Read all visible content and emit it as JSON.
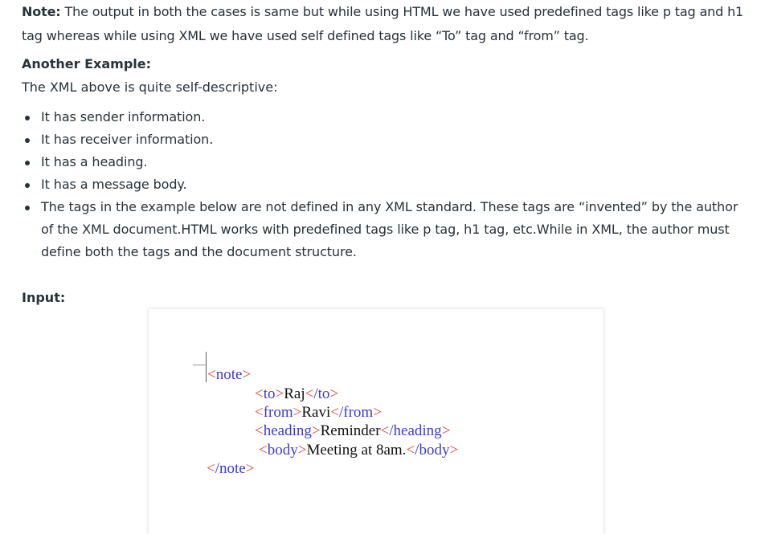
{
  "note": {
    "label": "Note:",
    "text": " The output in both the cases is same but while using HTML we have used predefined tags like p tag and h1 tag whereas while using XML we have used self defined tags like “To” tag and “from” tag."
  },
  "another_example": {
    "heading": "Another Example:",
    "intro": "The XML above is quite self-descriptive:"
  },
  "bullets": [
    "It has sender information.",
    "It has receiver information.",
    "It has a heading.",
    "It has a message body.",
    "The tags in the example below are not defined in any XML standard. These tags are “invented” by the author of the XML document.HTML works with predefined tags like p tag, h1 tag, etc.While in XML, the author must define both the tags and the document structure."
  ],
  "input_label": "Input:",
  "code": {
    "note_open": "note",
    "to_tag": "to",
    "to_value": "Raj",
    "from_tag": "from",
    "from_value": "Ravi",
    "heading_tag": "heading",
    "heading_value": "Reminder",
    "body_tag": "body",
    "body_value": "Meeting at 8am.",
    "note_close": "note"
  },
  "colors": {
    "text": "#273239",
    "tag_name": "#3b3bd6",
    "angle_bracket": "#e0483d"
  }
}
